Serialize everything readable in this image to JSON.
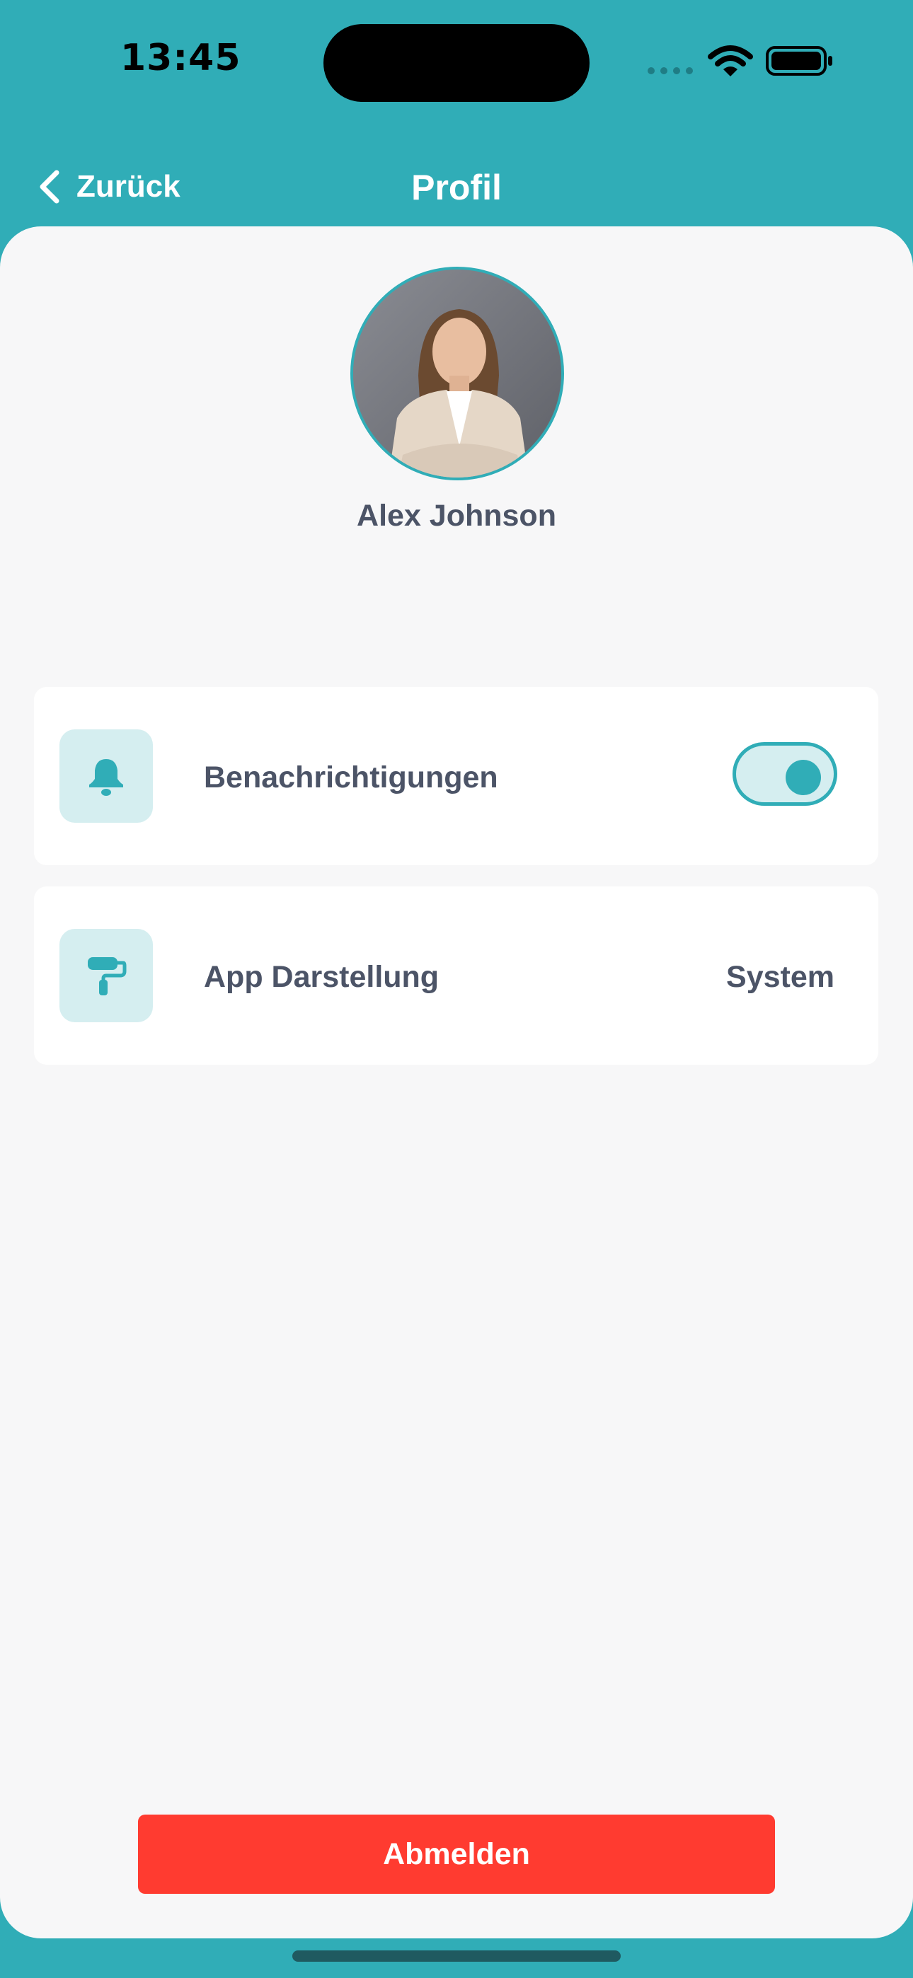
{
  "status_bar": {
    "time": "13:45",
    "icons": [
      "signal-dots-icon",
      "wifi-icon",
      "battery-icon"
    ]
  },
  "nav": {
    "back_label": "Zurück",
    "title": "Profil",
    "back_icon": "chevron-left-icon"
  },
  "profile": {
    "name": "Alex Johnson",
    "avatar": "avatar-photo"
  },
  "settings": {
    "notifications": {
      "label": "Benachrichtigungen",
      "icon": "bell-icon",
      "enabled": true
    },
    "appearance": {
      "label": "App Darstellung",
      "value": "System",
      "icon": "paint-roller-icon"
    }
  },
  "actions": {
    "logout_label": "Abmelden"
  },
  "colors": {
    "accent": "#30adb7",
    "accent_light": "#d5eef0",
    "background": "#f7f7f8",
    "text": "#4c5467",
    "danger": "#ff3b30"
  }
}
